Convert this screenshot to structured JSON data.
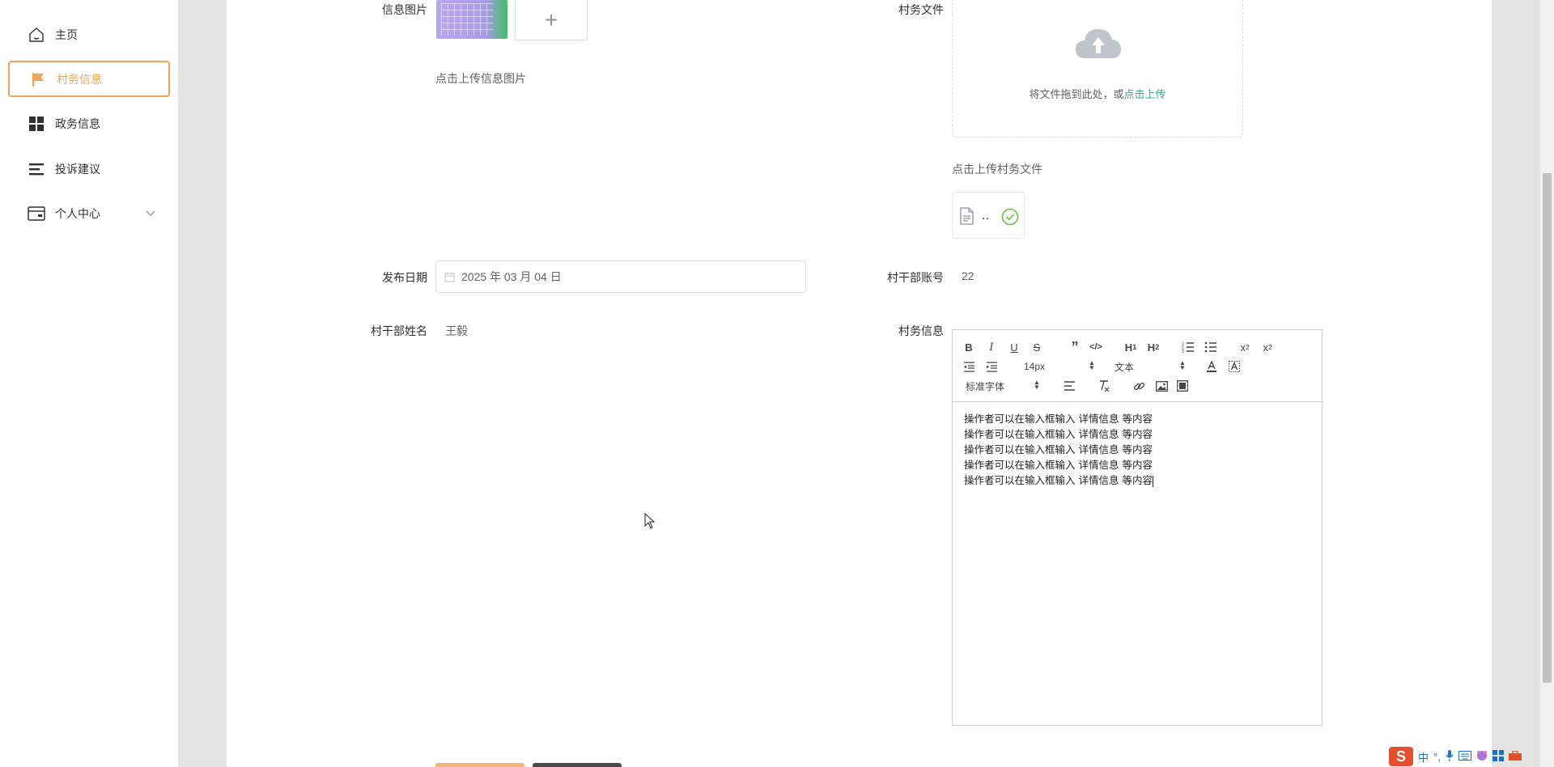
{
  "sidebar": {
    "items": [
      {
        "label": "主页",
        "icon": "home-icon"
      },
      {
        "label": "村务信息",
        "icon": "flag-icon",
        "active": true
      },
      {
        "label": "政务信息",
        "icon": "grid-icon"
      },
      {
        "label": "投诉建议",
        "icon": "list-icon"
      },
      {
        "label": "个人中心",
        "icon": "wallet-icon",
        "has_children": true
      }
    ]
  },
  "form": {
    "image_label": "信息图片",
    "image_hint": "点击上传信息图片",
    "file_label": "村务文件",
    "file_drop_text": "将文件拖到此处，或",
    "file_drop_link": "点击上传",
    "file_hint": "点击上传村务文件",
    "file_name": "..",
    "date_label": "发布日期",
    "date_value": "2025 年 03 月 04 日",
    "account_label": "村干部账号",
    "account_value": "22",
    "name_label": "村干部姓名",
    "name_value": "王毅",
    "info_label": "村务信息"
  },
  "editor": {
    "font_size": "14px",
    "text_style": "文本",
    "font_family": "标准字体",
    "lines": [
      "操作者可以在输入框输入 详情信息 等内容",
      "操作者可以在输入框输入 详情信息 等内容",
      "操作者可以在输入框输入 详情信息 等内容",
      "操作者可以在输入框输入 详情信息 等内容",
      "操作者可以在输入框输入 详情信息 等内容"
    ]
  },
  "tray": {
    "ime": "中",
    "punct": "°,"
  },
  "colors": {
    "accent": "#f0a35a",
    "link": "#3fa58a",
    "success": "#67c23a"
  }
}
